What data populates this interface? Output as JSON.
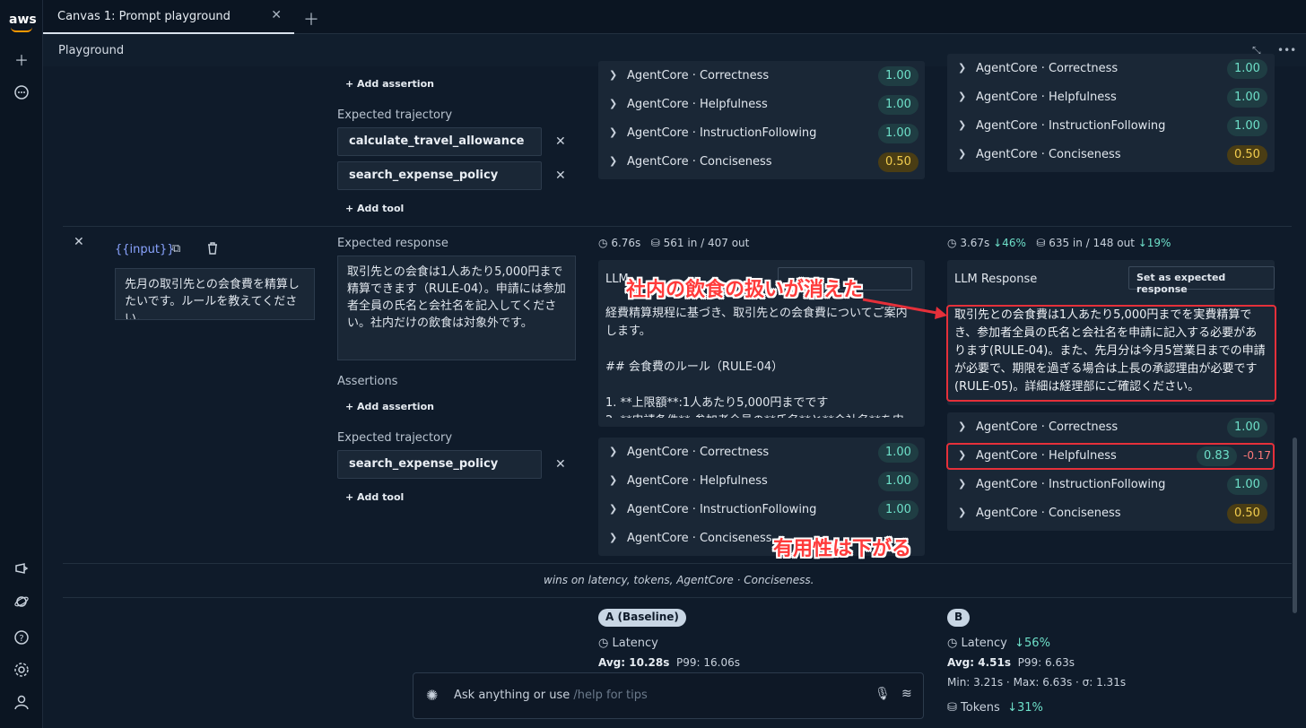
{
  "app": {
    "logo": "aws"
  },
  "tabs": [
    {
      "label": "Canvas 1: Prompt playground"
    }
  ],
  "header": {
    "title": "Playground"
  },
  "row1": {
    "add_assertion": "+ Add assertion",
    "expected_trajectory_label": "Expected trajectory",
    "trajectory": [
      "calculate_travel_allowance",
      "search_expense_policy"
    ],
    "add_tool": "+ Add tool",
    "metrics_a": [
      {
        "name": "AgentCore · Correctness",
        "score": "1.00"
      },
      {
        "name": "AgentCore · Helpfulness",
        "score": "1.00"
      },
      {
        "name": "AgentCore · InstructionFollowing",
        "score": "1.00"
      },
      {
        "name": "AgentCore · Conciseness",
        "score": "0.50"
      }
    ],
    "metrics_b": [
      {
        "name": "AgentCore · Correctness",
        "score": "1.00"
      },
      {
        "name": "AgentCore · Helpfulness",
        "score": "1.00"
      },
      {
        "name": "AgentCore · InstructionFollowing",
        "score": "1.00"
      },
      {
        "name": "AgentCore · Conciseness",
        "score": "0.50"
      }
    ]
  },
  "row2": {
    "variable": "{{input}}",
    "input_text": "先月の取引先との会食費を精算したいです。ルールを教えてください。",
    "expected_response_label": "Expected response",
    "expected_response": "取引先との会食は1人あたり5,000円まで精算できます（RULE-04）。申請には参加者全員の氏名と会社名を記入してください。社内だけの飲食は対象外です。",
    "assertions_label": "Assertions",
    "add_assertion": "+ Add assertion",
    "expected_trajectory_label": "Expected trajectory",
    "trajectory": [
      "search_expense_policy"
    ],
    "add_tool": "+ Add tool",
    "a": {
      "latency": "6.76s",
      "tokens": "561 in / 407 out",
      "response_label": "LLM",
      "response": "経費精算規程に基づき、取引先との会食費についてご案内します。\n\n## 会食費のルール（RULE-04）\n\n1. **上限額**:1人あたり5,000円までです\n2. **申請条件**:参加者全員の**氏名**と**会社名**を申",
      "metrics": [
        {
          "name": "AgentCore · Correctness",
          "score": "1.00"
        },
        {
          "name": "AgentCore · Helpfulness",
          "score": "1.00"
        },
        {
          "name": "AgentCore · InstructionFollowing",
          "score": "1.00"
        },
        {
          "name": "AgentCore · Conciseness",
          "score": ""
        }
      ]
    },
    "b": {
      "latency": "3.67s",
      "latency_delta": "↓46%",
      "tokens": "635 in / 148 out",
      "tokens_delta": "↓19%",
      "response_label": "LLM Response",
      "set_expected_button": "Set as expected response",
      "response": "取引先との会食費は1人あたり5,000円までを実費精算でき、参加者全員の氏名と会社名を申請に記入する必要があります(RULE-04)。また、先月分は今月5営業日までの申請が必要で、期限を過ぎる場合は上長の承認理由が必要です(RULE-05)。詳細は経理部にご確認ください。",
      "metrics": [
        {
          "name": "AgentCore · Correctness",
          "score": "1.00",
          "delta": ""
        },
        {
          "name": "AgentCore · Helpfulness",
          "score": "0.83",
          "delta": "-0.17"
        },
        {
          "name": "AgentCore · InstructionFollowing",
          "score": "1.00",
          "delta": ""
        },
        {
          "name": "AgentCore · Conciseness",
          "score": "0.50",
          "delta": ""
        }
      ]
    }
  },
  "annotations": {
    "top": "社内の飲食の扱いが消えた",
    "bottom": "有用性は下がる"
  },
  "summary": {
    "wins": "wins on latency, tokens, AgentCore · Conciseness.",
    "a_badge": "A (Baseline)",
    "a_latency_label": "Latency",
    "a_avg": "Avg: 10.28s",
    "a_p99": "P99: 16.06s",
    "b_badge": "B",
    "b_latency_label": "Latency",
    "b_latency_delta": "↓56%",
    "b_avg": "Avg: 4.51s",
    "b_p99": "P99: 6.63s",
    "b_minmax": "Min: 3.21s · Max: 6.63s · σ: 1.31s",
    "b_tokens_label": "Tokens",
    "b_tokens_delta": "↓31%"
  },
  "chat": {
    "placeholder": "Ask anything or use",
    "hint": "/help for tips"
  },
  "colors": {
    "accent_green": "#6ee0c9",
    "warn_yellow": "#f2cd4e",
    "annotation_red": "#e5303a"
  }
}
